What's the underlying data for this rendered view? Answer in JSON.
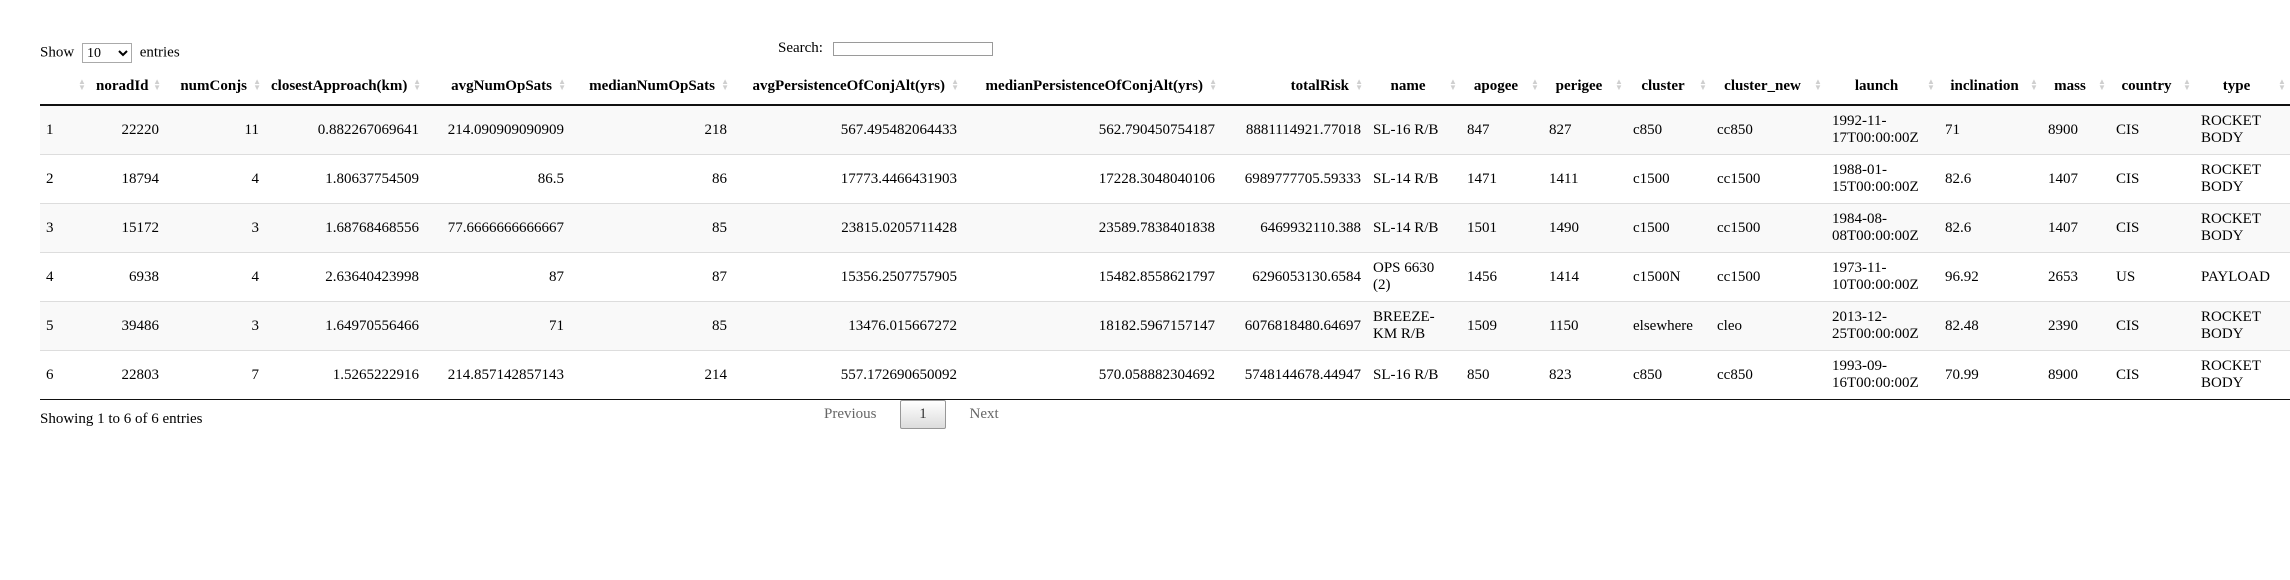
{
  "length_control": {
    "prefix": "Show",
    "selected": "10",
    "suffix": "entries"
  },
  "search": {
    "label": "Search:",
    "value": ""
  },
  "table": {
    "columns": [
      "",
      "noradId",
      "numConjs",
      "closestApproach(km)",
      "avgNumOpSats",
      "medianNumOpSats",
      "avgPersistenceOfConjAlt(yrs)",
      "medianPersistenceOfConjAlt(yrs)",
      "totalRisk",
      "name",
      "apogee",
      "perigee",
      "cluster",
      "cluster_new",
      "launch",
      "inclination",
      "mass",
      "country",
      "type"
    ],
    "rows": [
      [
        "1",
        "22220",
        "11",
        "0.882267069641",
        "214.090909090909",
        "218",
        "567.495482064433",
        "562.790450754187",
        "8881114921.77018",
        "SL-16 R/B",
        "847",
        "827",
        "c850",
        "cc850",
        "1992-11-17T00:00:00Z",
        "71",
        "8900",
        "CIS",
        "ROCKET BODY"
      ],
      [
        "2",
        "18794",
        "4",
        "1.80637754509",
        "86.5",
        "86",
        "17773.4466431903",
        "17228.3048040106",
        "6989777705.59333",
        "SL-14 R/B",
        "1471",
        "1411",
        "c1500",
        "cc1500",
        "1988-01-15T00:00:00Z",
        "82.6",
        "1407",
        "CIS",
        "ROCKET BODY"
      ],
      [
        "3",
        "15172",
        "3",
        "1.68768468556",
        "77.6666666666667",
        "85",
        "23815.0205711428",
        "23589.7838401838",
        "6469932110.388",
        "SL-14 R/B",
        "1501",
        "1490",
        "c1500",
        "cc1500",
        "1984-08-08T00:00:00Z",
        "82.6",
        "1407",
        "CIS",
        "ROCKET BODY"
      ],
      [
        "4",
        "6938",
        "4",
        "2.63640423998",
        "87",
        "87",
        "15356.2507757905",
        "15482.8558621797",
        "6296053130.6584",
        "OPS 6630 (2)",
        "1456",
        "1414",
        "c1500N",
        "cc1500",
        "1973-11-10T00:00:00Z",
        "96.92",
        "2653",
        "US",
        "PAYLOAD"
      ],
      [
        "5",
        "39486",
        "3",
        "1.64970556466",
        "71",
        "85",
        "13476.015667272",
        "18182.5967157147",
        "6076818480.64697",
        "BREEZE-KM R/B",
        "1509",
        "1150",
        "elsewhere",
        "cleo",
        "2013-12-25T00:00:00Z",
        "82.48",
        "2390",
        "CIS",
        "ROCKET BODY"
      ],
      [
        "6",
        "22803",
        "7",
        "1.5265222916",
        "214.857142857143",
        "214",
        "557.172690650092",
        "570.058882304692",
        "5748144678.44947",
        "SL-16 R/B",
        "850",
        "823",
        "c850",
        "cc850",
        "1993-09-16T00:00:00Z",
        "70.99",
        "8900",
        "CIS",
        "ROCKET BODY"
      ]
    ]
  },
  "info": "Showing 1 to 6 of 6 entries",
  "pagination": {
    "previous": "Previous",
    "current": "1",
    "next": "Next"
  }
}
